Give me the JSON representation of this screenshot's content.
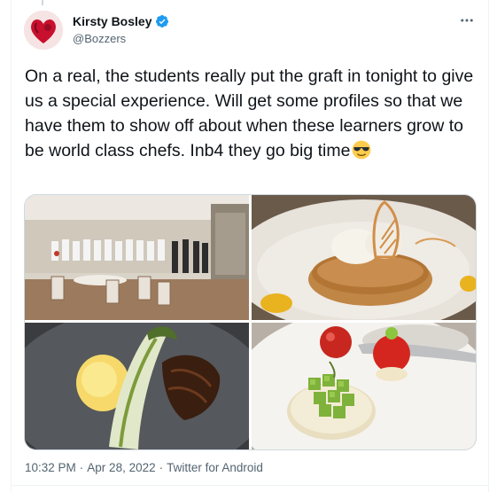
{
  "author": {
    "display_name": "Kirsty Bosley",
    "handle": "@Bozzers",
    "verified": true
  },
  "tweet": {
    "text": "On a real, the students really put the graft in tonight to give us a special experience. Will get some profiles so that we have them to show off about when these learners grow to be world class chefs. Inb4 they go big time",
    "emoji": "smiling-face-with-sunglasses"
  },
  "media": [
    {
      "name": "group-photo",
      "icon": "photo"
    },
    {
      "name": "dessert-tart-photo",
      "icon": "photo"
    },
    {
      "name": "main-course-photo",
      "icon": "photo"
    },
    {
      "name": "appetizer-photo",
      "icon": "photo"
    }
  ],
  "meta": {
    "time": "10:32 PM",
    "separator1": "·",
    "date": "Apr 28, 2022",
    "separator2": "·",
    "source": "Twitter for Android"
  },
  "colors": {
    "text": "#0f1419",
    "secondary": "#536471",
    "verified": "#1d9bf0",
    "border": "#cfd9de"
  },
  "icons": {
    "more": "more-horizontal-icon",
    "verified": "verified-badge-icon"
  }
}
